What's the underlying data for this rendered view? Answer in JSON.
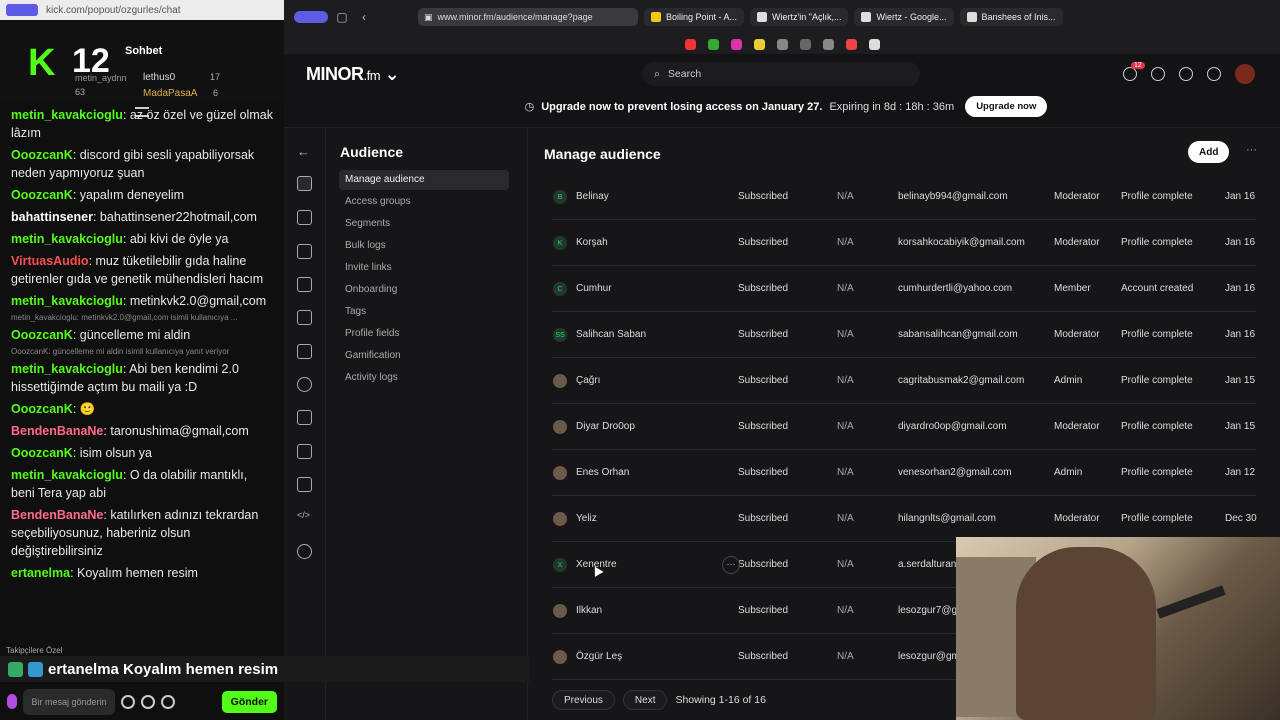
{
  "chat": {
    "url": "kick.com/popout/ozgurles/chat",
    "channel_number": "12",
    "title": "Sohbet",
    "leaderboard": [
      {
        "name": "metin_aydnn",
        "count": "63"
      },
      {
        "name": "lethus0",
        "count": "17"
      },
      {
        "name": "MadaPasaA",
        "count": "6"
      }
    ],
    "messages": [
      {
        "user": "metin_kavakcioglu",
        "color": "#53fc18",
        "text": "az öz özel ve güzel olmak lâzım"
      },
      {
        "user": "OoozcanK",
        "color": "#53fc18",
        "text": "discord gibi sesli yapabiliyorsak neden yapmıyoruz şuan"
      },
      {
        "user": "OoozcanK",
        "color": "#53fc18",
        "text": "yapalım deneyelim"
      },
      {
        "user": "bahattinsener",
        "color": "#ffffff",
        "text": "bahattinsener22hotmail,com"
      },
      {
        "user": "metin_kavakcioglu",
        "color": "#53fc18",
        "text": "abi kivi de öyle ya"
      },
      {
        "user": "VirtuasAudio",
        "color": "#ff4d4d",
        "text": "muz tüketilebilir gıda haline getirenler gıda ve genetik mühendisleri hacım"
      },
      {
        "user": "metin_kavakcioglu",
        "color": "#53fc18",
        "text": "metinkvk2.0@gmail,com"
      },
      {
        "reply": "metin_kavakcioglu: metinkvk2.0@gmail,com isimli kullanıcıya ..."
      },
      {
        "user": "OoozcanK",
        "color": "#53fc18",
        "text": "güncelleme mi aldin"
      },
      {
        "reply": "OoozcanK: güncelleme mi aldin isimli kullanıcıya yanıt veriyor"
      },
      {
        "user": "metin_kavakcioglu",
        "color": "#53fc18",
        "text": "Abi ben kendimi 2.0 hissettiğimde açtım bu maili ya :D"
      },
      {
        "user": "OoozcanK",
        "color": "#53fc18",
        "text": "🙂"
      },
      {
        "user": "BendenBanaNe",
        "color": "#ff6b8a",
        "text": "taronushima@gmail,com"
      },
      {
        "user": "OoozcanK",
        "color": "#53fc18",
        "text": "isim olsun ya"
      },
      {
        "user": "metin_kavakcioglu",
        "color": "#53fc18",
        "text": "O da olabilir mantıklı, beni Tera yap abi"
      },
      {
        "user": "BendenBanaNe",
        "color": "#ff6b8a",
        "text": "katılırken adınızı tekrardan seçebiliyosunuz, haberiniz olsun değiştirebilirsiniz"
      },
      {
        "user": "ertanelma",
        "color": "#53fc18",
        "text": "Koyalım hemen resim"
      }
    ],
    "followers_only": "Takipçilere Özel",
    "pinned_user": "ertanelma",
    "pinned_text": "Koyalım hemen resim",
    "input_placeholder": "Bir mesaj gönderin",
    "send_label": "Gönder"
  },
  "browser": {
    "address": "www.minor.fm/audience/manage?page",
    "tabs": [
      "Boiling Point - A...",
      "Wiertz'in \"Açlık,...",
      "Wiertz - Google...",
      "Banshees of Inis..."
    ]
  },
  "app": {
    "logo": "MINOR",
    "logo_suffix": ".fm",
    "search_placeholder": "Search",
    "notification_count": "12",
    "banner_text": "Upgrade now to prevent losing access on January 27.",
    "banner_expiry": "Expiring in 8d : 18h : 36m",
    "upgrade_button": "Upgrade now",
    "nav_title": "Audience",
    "nav_items": [
      "Manage audience",
      "Access groups",
      "Segments",
      "Bulk logs",
      "Invite links",
      "Onboarding",
      "Tags",
      "Profile fields",
      "Gamification",
      "Activity logs"
    ],
    "main_title": "Manage audience",
    "add_button": "Add",
    "rows": [
      {
        "initials": "B",
        "name": "Belinay",
        "status": "Subscribed",
        "na": "N/A",
        "email": "belinayb994@gmail.com",
        "role": "Moderator",
        "profile": "Profile complete",
        "date": "Jan 16"
      },
      {
        "initials": "K",
        "name": "Korşah",
        "status": "Subscribed",
        "na": "N/A",
        "email": "korsahkocabiyik@gmail.com",
        "role": "Moderator",
        "profile": "Profile complete",
        "date": "Jan 16"
      },
      {
        "initials": "C",
        "name": "Cumhur",
        "status": "Subscribed",
        "na": "N/A",
        "email": "cumhurdertli@yahoo.com",
        "role": "Member",
        "profile": "Account created",
        "date": "Jan 16"
      },
      {
        "initials": "SS",
        "name": "Salihcan Saban",
        "status": "Subscribed",
        "na": "N/A",
        "email": "sabansalihcan@gmail.com",
        "role": "Moderator",
        "profile": "Profile complete",
        "date": "Jan 16"
      },
      {
        "initials": "",
        "name": "Çağrı",
        "status": "Subscribed",
        "na": "N/A",
        "email": "cagritabusmak2@gmail.com",
        "role": "Admin",
        "profile": "Profile complete",
        "date": "Jan 15"
      },
      {
        "initials": "",
        "name": "Diyar Dro0op",
        "status": "Subscribed",
        "na": "N/A",
        "email": "diyardro0op@gmail.com",
        "role": "Moderator",
        "profile": "Profile complete",
        "date": "Jan 15"
      },
      {
        "initials": "",
        "name": "Enes Orhan",
        "status": "Subscribed",
        "na": "N/A",
        "email": "venesorhan2@gmail.com",
        "role": "Admin",
        "profile": "Profile complete",
        "date": "Jan 12"
      },
      {
        "initials": "",
        "name": "Yeliz",
        "status": "Subscribed",
        "na": "N/A",
        "email": "hilangnlts@gmail.com",
        "role": "Moderator",
        "profile": "Profile complete",
        "date": "Dec 30"
      },
      {
        "initials": "X",
        "name": "Xenentre",
        "status": "Subscribed",
        "na": "N/A",
        "email": "a.serdalturan",
        "role": "",
        "profile": "",
        "date": ""
      },
      {
        "initials": "",
        "name": "Ilkkan",
        "status": "Subscribed",
        "na": "N/A",
        "email": "lesozgur7@g",
        "role": "",
        "profile": "",
        "date": ""
      },
      {
        "initials": "",
        "name": "Özgür Leş",
        "status": "Subscribed",
        "na": "N/A",
        "email": "lesozgur@gm",
        "role": "",
        "profile": "",
        "date": ""
      }
    ],
    "pager_previous": "Previous",
    "pager_next": "Next",
    "pager_info": "Showing 1-16 of 16"
  }
}
